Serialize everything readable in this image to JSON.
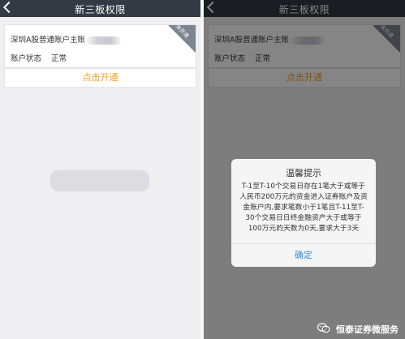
{
  "screens": {
    "left": {
      "header": {
        "title": "新三板权限"
      },
      "account": {
        "label": "深圳A股普通账户主账",
        "status_label": "账户状态",
        "status_value": "正常",
        "corner_badge": "未开通"
      },
      "open_button": {
        "label": "点击开通"
      }
    },
    "right": {
      "header": {
        "title": "新三板权限"
      },
      "account": {
        "label": "深圳A股普通账户主账",
        "status_label": "账户状态",
        "status_value": "正常",
        "corner_badge": "未开通"
      },
      "open_button": {
        "label": "点击开通"
      },
      "dialog": {
        "title": "温馨提示",
        "message": "T-1至T-10个交易日存在1笔大于或等于人民币200万元的资金进入证券账户及资金账户内,要求笔数小于1笔且T-11至T-30个交易日日终金融资产大于或等于100万元的天数为0天,要求大于3天",
        "confirm_label": "确定"
      }
    }
  },
  "watermark": {
    "text": "恒泰证券微服务"
  },
  "colors": {
    "navbar": "#333a44",
    "accent": "#f0a21f",
    "link": "#3b8bd9"
  }
}
